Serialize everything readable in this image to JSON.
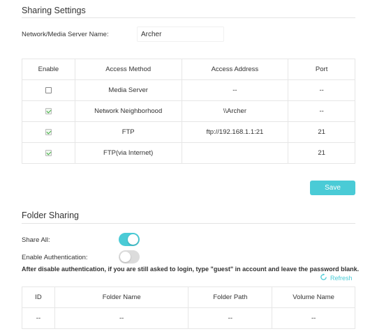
{
  "sharing": {
    "title": "Sharing Settings",
    "server_name_label": "Network/Media Server Name:",
    "server_name_value": "Archer",
    "columns": [
      "Enable",
      "Access Method",
      "Access Address",
      "Port"
    ],
    "rows": [
      {
        "enabled": false,
        "method": "Media Server",
        "address": "--",
        "port": "--"
      },
      {
        "enabled": true,
        "method": "Network Neighborhood",
        "address": "\\\\Archer",
        "port": "--"
      },
      {
        "enabled": true,
        "method": "FTP",
        "address": "ftp://192.168.1.1:21",
        "port": "21"
      },
      {
        "enabled": true,
        "method": "FTP(via Internet)",
        "address": "",
        "port": "21"
      }
    ],
    "save_label": "Save"
  },
  "folder": {
    "title": "Folder Sharing",
    "share_all_label": "Share All:",
    "share_all_on": true,
    "auth_label": "Enable Authentication:",
    "auth_on": false,
    "notice": "After disable authentication, if you are still asked to login, type \"guest\" in account and leave the password blank.",
    "refresh_label": "Refresh",
    "columns": [
      "ID",
      "Folder Name",
      "Folder Path",
      "Volume Name"
    ],
    "rows": [
      {
        "id": "--",
        "name": "--",
        "path": "--",
        "volume": "--"
      }
    ]
  },
  "colors": {
    "accent": "#4acbd6",
    "check": "#3aaa3a"
  }
}
